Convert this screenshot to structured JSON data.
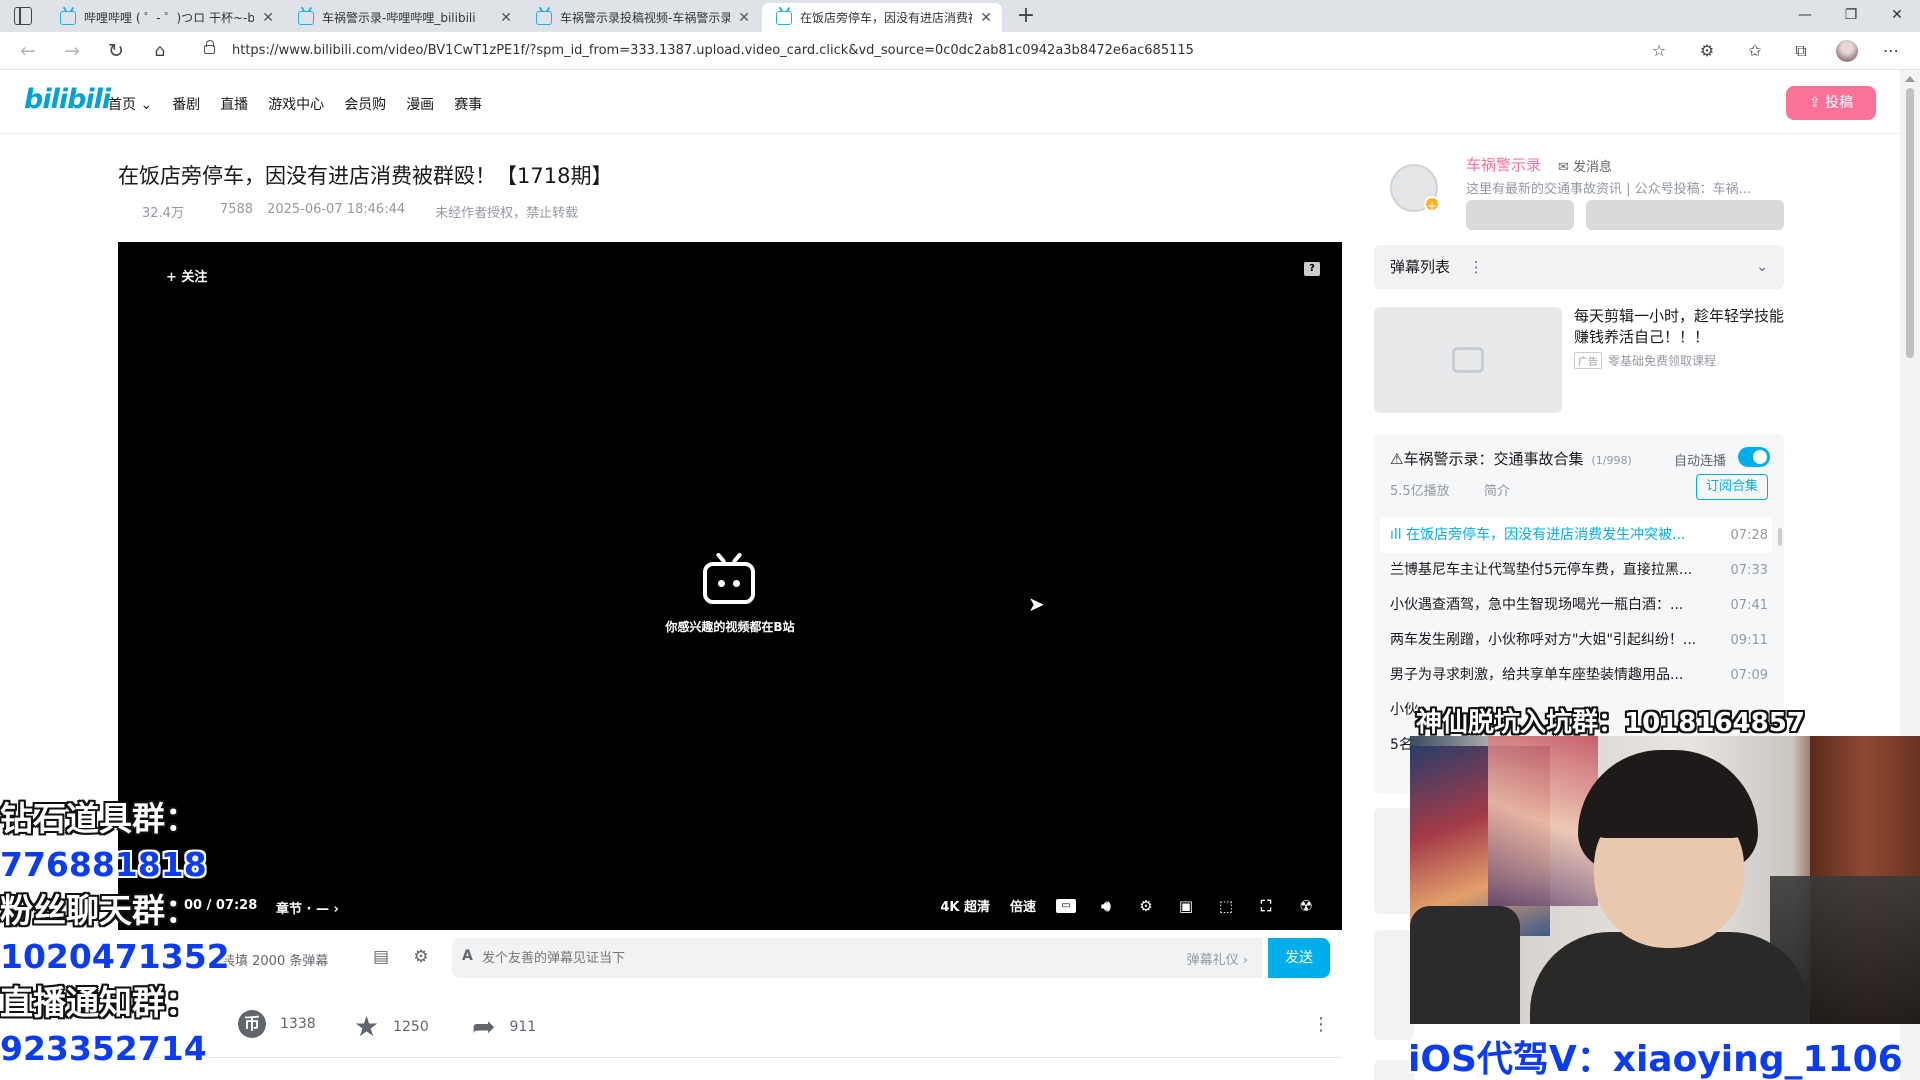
{
  "browser": {
    "tabs": [
      {
        "title": "哔哩哔哩 ( ゜- ゜)つロ 干杯~-bilibili",
        "active": false
      },
      {
        "title": "车祸警示录-哔哩哔哩_bilibili",
        "active": false
      },
      {
        "title": "车祸警示录投稿视频-车祸警示录",
        "active": false
      },
      {
        "title": "在饭店旁停车，因没有进店消费被群殴",
        "active": true
      }
    ],
    "url": "https://www.bilibili.com/video/BV1CwT1zPE1f/?spm_id_from=333.1387.upload.video_card.click&vd_source=0c0dc2ab81c0942a3b8472e6ac685115"
  },
  "header": {
    "logo": "bilibili",
    "nav": [
      "首页 ⌄",
      "番剧",
      "直播",
      "游戏中心",
      "会员购",
      "漫画",
      "赛事"
    ],
    "upload_label": "投稿"
  },
  "video": {
    "title": "在饭店旁停车，因没有进店消费被群殴！【1718期】",
    "views": "32.4万",
    "danmaku_count": "7588",
    "date": "2025-06-07 18:46:44",
    "copyright": "未经作者授权，禁止转载"
  },
  "player": {
    "follow_label": "+ 关注",
    "slogan": "你感兴趣的视频都在B站",
    "time": "00 / 07:28",
    "chapter": "章节 · — ›",
    "quality": "4K 超清",
    "speed": "倍速",
    "subtitle": "字幕"
  },
  "danmaku": {
    "loaded_text": "装填 2000 条弹幕",
    "placeholder": "发个友善的弹幕见证当下",
    "etiquette": "弹幕礼仪 ›",
    "send_label": "发送"
  },
  "actions": {
    "coin_count": "1338",
    "fav_count": "1250",
    "share_count": "911"
  },
  "uploader": {
    "name": "车祸警示录",
    "message_label": "发消息",
    "desc": "这里有最新的交通事故资讯 | 公众号投稿：车祸..."
  },
  "danmaku_list": {
    "label": "弹幕列表"
  },
  "ad": {
    "title": "每天剪辑一小时，趁年轻学技能赚钱养活自己！！！",
    "badge": "广告",
    "tag": "零基础免费领取课程"
  },
  "playlist": {
    "title": "⚠车祸警示录：交通事故合集",
    "count": "(1/998)",
    "autoplay_label": "自动连播",
    "plays": "5.5亿播放",
    "intro": "简介",
    "subscribe_label": "订阅合集",
    "items": [
      {
        "name": "在饭店旁停车，因没有进店消费发生冲突被...",
        "duration": "07:28"
      },
      {
        "name": "兰博基尼车主让代驾垫付5元停车费，直接拉黑...",
        "duration": "07:33"
      },
      {
        "name": "小伙遇查酒驾，急中生智现场喝光一瓶白酒：...",
        "duration": "07:41"
      },
      {
        "name": "两车发生剐蹭，小伙称呼对方\"大姐\"引起纠纷！...",
        "duration": "09:11"
      },
      {
        "name": "男子为寻求刺激，给共享单车座垫装情趣用品...",
        "duration": "07:09"
      },
      {
        "name": "小伙",
        "duration": ""
      },
      {
        "name": "5名",
        "duration": ""
      }
    ]
  },
  "overlay": {
    "left_lines": [
      {
        "text": "钻石道具群：",
        "blue": false
      },
      {
        "text": "776881818",
        "blue": true
      },
      {
        "text": "粉丝聊天群：",
        "blue": false
      },
      {
        "text": "1020471352",
        "blue": true
      },
      {
        "text": "直播通知群：",
        "blue": false
      },
      {
        "text": "923352714",
        "blue": true
      }
    ],
    "top_right": "神仙脱坑入坑群：1018164857",
    "bottom_right": "iOS代驾V：xiaoying_1106"
  },
  "colors": {
    "accent": "#00aeec",
    "pink": "#fb7299",
    "overlay_blue": "#0c3cf2"
  }
}
